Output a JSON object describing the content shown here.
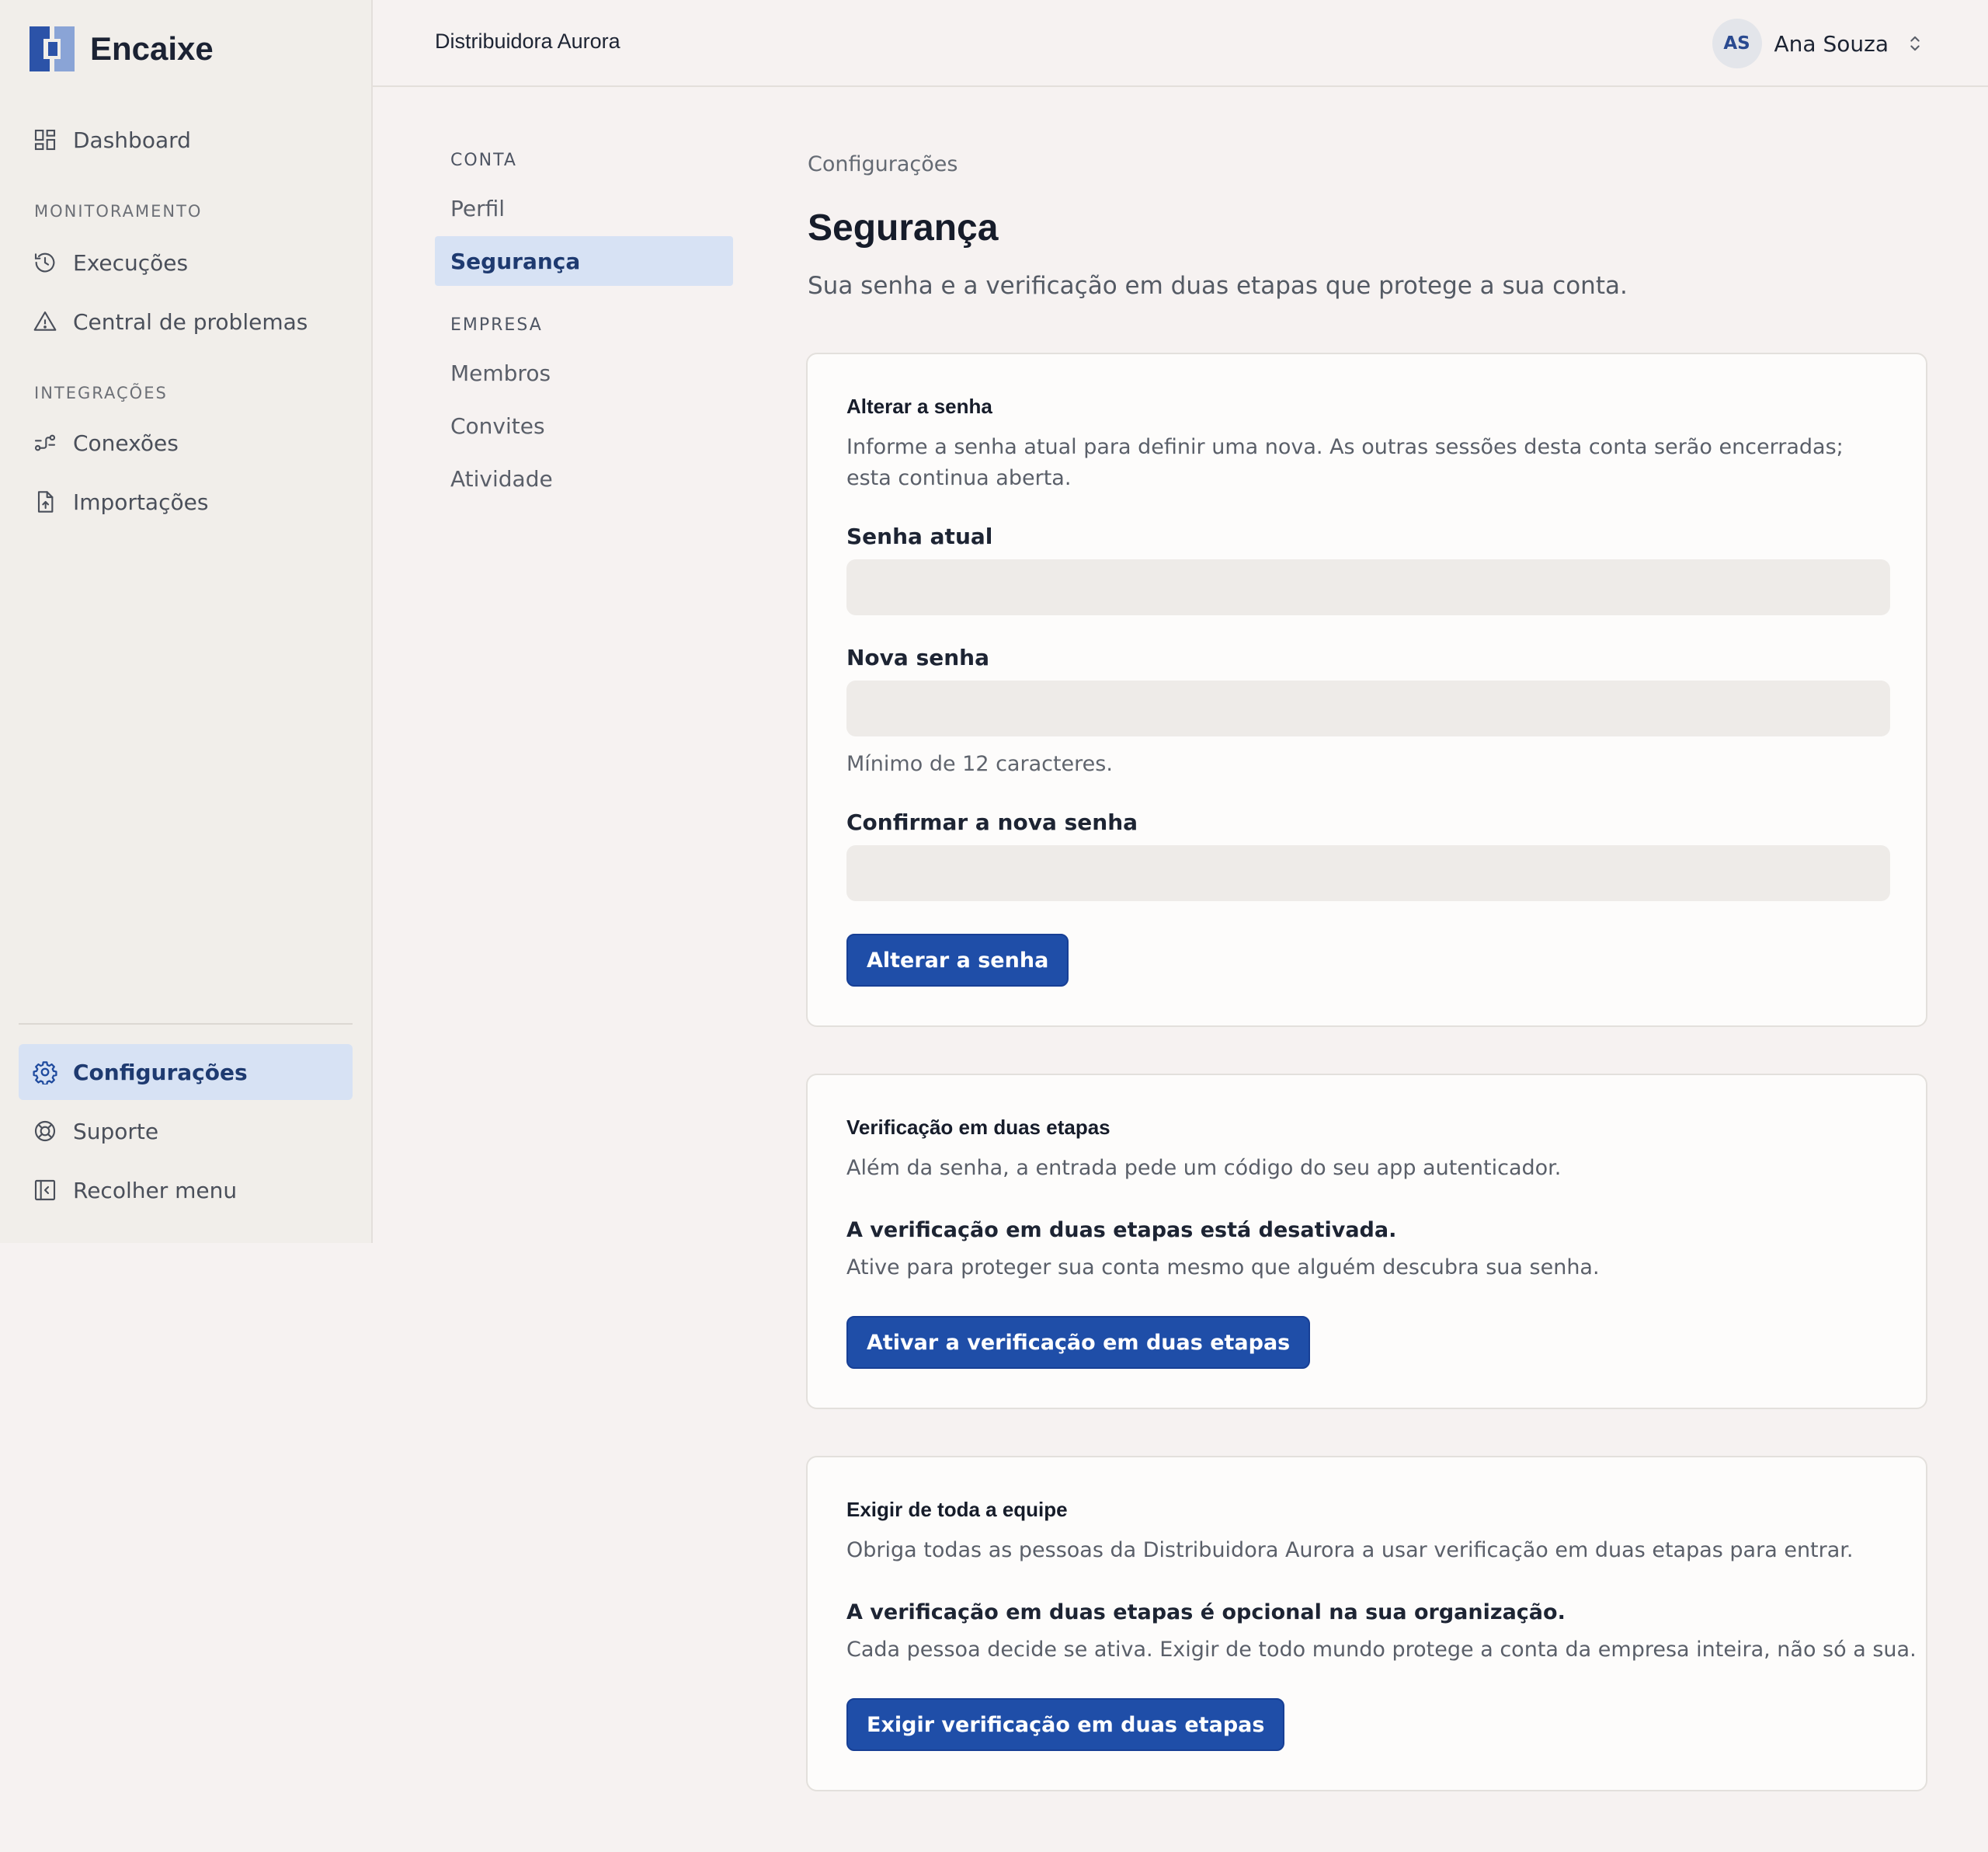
{
  "app": {
    "brand_name": "Encaixe",
    "brand_colors": {
      "primary": "#2c53a8",
      "secondary": "#8aa4d6"
    },
    "accent_color": "#1f4ea8"
  },
  "sidebar": {
    "dashboard": {
      "label": "Dashboard",
      "icon": "grid-icon"
    },
    "section_monitoring": "MONITORAMENTO",
    "executions": {
      "label": "Execuções",
      "icon": "history-icon"
    },
    "problems": {
      "label": "Central de problemas",
      "icon": "warning-icon"
    },
    "section_integrations": "INTEGRAÇÕES",
    "connections": {
      "label": "Conexões",
      "icon": "connection-icon"
    },
    "imports": {
      "label": "Importações",
      "icon": "file-upload-icon"
    },
    "settings": {
      "label": "Configurações",
      "icon": "gear-icon",
      "active": true
    },
    "support": {
      "label": "Suporte",
      "icon": "lifebuoy-icon"
    },
    "collapse": {
      "label": "Recolher menu",
      "icon": "collapse-sidebar-icon"
    }
  },
  "topbar": {
    "org_name": "Distribuidora Aurora",
    "user_initials": "AS",
    "user_name": "Ana Souza"
  },
  "subnav": {
    "section_account": "CONTA",
    "profile": "Perfil",
    "security": "Segurança",
    "section_company": "EMPRESA",
    "members": "Membros",
    "invites": "Convites",
    "activity": "Atividade"
  },
  "page": {
    "breadcrumb": "Configurações",
    "title": "Segurança",
    "subtitle": "Sua senha e a verificação em duas etapas que protege a sua conta."
  },
  "password_card": {
    "title": "Alterar a senha",
    "description": "Informe a senha atual para definir uma nova. As outras sessões desta conta serão encerradas; esta continua aberta.",
    "current_label": "Senha atual",
    "current_value": "",
    "new_label": "Nova senha",
    "new_value": "",
    "new_hint": "Mínimo de 12 caracteres.",
    "confirm_label": "Confirmar a nova senha",
    "confirm_value": "",
    "submit_label": "Alterar a senha"
  },
  "twofa_card": {
    "title": "Verificação em duas etapas",
    "description": "Além da senha, a entrada pede um código do seu app autenticador.",
    "status_title": "A verificação em duas etapas está desativada.",
    "status_desc": "Ative para proteger sua conta mesmo que alguém descubra sua senha.",
    "button_label": "Ativar a verificação em duas etapas"
  },
  "team_card": {
    "title": "Exigir de toda a equipe",
    "description": "Obriga todas as pessoas da Distribuidora Aurora a usar verificação em duas etapas para entrar.",
    "status_title": "A verificação em duas etapas é opcional na sua organização.",
    "status_desc": "Cada pessoa decide se ativa. Exigir de todo mundo protege a conta da empresa inteira, não só a sua.",
    "button_label": "Exigir verificação em duas etapas"
  }
}
